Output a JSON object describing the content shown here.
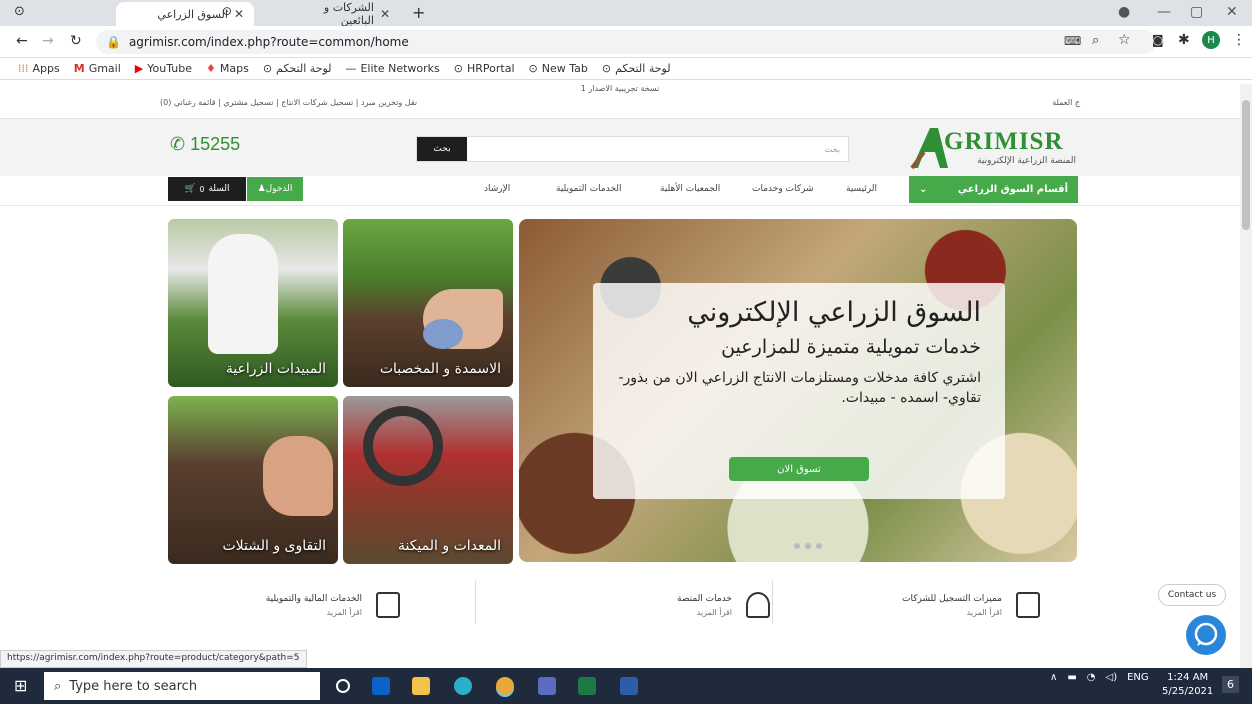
{
  "browser": {
    "tabs": [
      {
        "label": "السوق الزراعي",
        "active": true
      },
      {
        "label": "الشركات و البائعين",
        "active": false
      }
    ],
    "new_tab": "+",
    "url": "agrimisr.com/index.php?route=common/home",
    "profile_initial": "H",
    "bookmarks": [
      "Apps",
      "Gmail",
      "YouTube",
      "Maps",
      "لوحة التحكم",
      "Elite Networks",
      "HRPortal",
      "New Tab",
      "لوحة التحكم"
    ],
    "status_url": "https://agrimisr.com/index.php?route=product/category&path=5"
  },
  "site": {
    "beta_label": "نسخة تجريبية الاصدار 1",
    "currency": "ج العملة",
    "util_links": "نقل وتخزين مبرد  |  تسجيل شركات الانتاج  |  تسجيل مشتري  |  قائمة رغباتي (0)",
    "phone": "15255",
    "search_placeholder": "بحث",
    "search_button": "بحث",
    "logo_name": "GRIMISR",
    "logo_sub": "المنصة الزراعية الإلكترونية",
    "categories_label": "أقسام السوق الزراعي",
    "nav": [
      "الرئيسية",
      "شركات وخدمات",
      "الجمعيات الأهلية",
      "الخدمات التمويلية",
      "الإرشاد"
    ],
    "login": "الدخول",
    "cart": "السلة",
    "cart_count": "0",
    "tiles": [
      "المبيدات الزراعية",
      "الاسمدة و المخصبات",
      "التقاوى و الشتلات",
      "المعدات و الميكنة"
    ],
    "hero": {
      "title": "السوق الزراعي الإلكتروني",
      "subtitle": "خدمات تمويلية متميزة للمزارعين",
      "body": "اشتري كافة مدخلات ومستلزمات الانتاج الزراعي الان من بذور- تقاوي- اسمده - مبيدات.",
      "button": "تسوق الان"
    },
    "features": [
      {
        "title": "مميزات التسجيل للشركات",
        "more": "اقرأ المزيد"
      },
      {
        "title": "خدمات المنصة",
        "more": "اقرأ المزيد"
      },
      {
        "title": "الخدمات المالية والتمويلية",
        "more": "اقرأ المزيد"
      }
    ],
    "contact": "Contact us"
  },
  "taskbar": {
    "search_placeholder": "Type here to search",
    "lang": "ENG",
    "time": "1:24 AM",
    "date": "5/25/2021",
    "notif": "6"
  }
}
